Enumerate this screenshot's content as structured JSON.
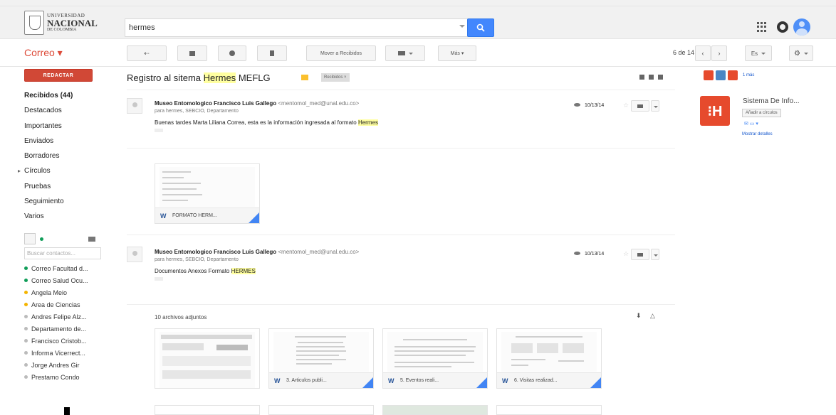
{
  "header": {
    "logo_line1": "UNIVERSIDAD",
    "logo_line2": "NACIONAL",
    "logo_line3": "DE COLOMBIA",
    "search_value": "hermes"
  },
  "toolbar": {
    "app_label": "Correo ▾",
    "move_inbox": "Mover a Recibidos",
    "more": "Más ▾",
    "pager": "6 de 14",
    "lang": "Es"
  },
  "sidebar": {
    "compose": "REDACTAR",
    "items": [
      "Recibidos (44)",
      "Destacados",
      "Importantes",
      "Enviados",
      "Borradores",
      "Círculos",
      "Pruebas",
      "Seguimiento",
      "Varios"
    ],
    "chat_search_placeholder": "Buscar contactos...",
    "contacts": [
      {
        "name": "Correo Facultad d...",
        "color": "#0f9d58"
      },
      {
        "name": "Correo Salud Ocu...",
        "color": "#0f9d58"
      },
      {
        "name": "Angela Meio",
        "color": "#f4b400"
      },
      {
        "name": "Area de Ciencias",
        "color": "#f4b400"
      },
      {
        "name": "Andres Felipe Alz...",
        "color": "#bbbbbb"
      },
      {
        "name": "Departamento de...",
        "color": "#bbbbbb"
      },
      {
        "name": "Francisco Cristob...",
        "color": "#bbbbbb"
      },
      {
        "name": "Informa Vicerrect...",
        "color": "#bbbbbb"
      },
      {
        "name": "Jorge Andres Gir",
        "color": "#bbbbbb"
      },
      {
        "name": "Prestamo Condo",
        "color": "#bbbbbb"
      }
    ]
  },
  "thread": {
    "subject_prefix": "Registro al sitema",
    "subject_hl": "Hermes",
    "subject_suffix": "MEFLG",
    "label": "Recibidos",
    "messages": [
      {
        "sender": "Museo Entomologico Francisco Luis Gallego",
        "email": "<mentomol_med@unal.edu.co>",
        "to": "para hermes, SEBCIO, Departamento",
        "body_prefix": "Buenas tardes Marta Liliana Correa, esta es la información ingresada al formato",
        "body_hl": "Hermes",
        "date": "10/13/14"
      },
      {
        "sender": "Museo Entomologico Francisco Luis Gallego",
        "email": "<mentomol_med@unal.edu.co>",
        "to": "para hermes, SEBCIO, Departamento",
        "body_prefix": "Documentos Anexos Formato",
        "body_hl": "HERMES",
        "date": "10/13/14"
      }
    ],
    "attachment_single": "FORMATO HERM...",
    "attachments_title": "10 archivos adjuntos",
    "attachments": [
      "",
      "3. Articulos publi...",
      "5. Eventos reali...",
      "6. Visitas realizad..."
    ]
  },
  "right_panel": {
    "more": "1 más",
    "title": "Sistema De Info...",
    "add_btn": "Añadir a círculos",
    "link": "Mostrar detalles"
  }
}
